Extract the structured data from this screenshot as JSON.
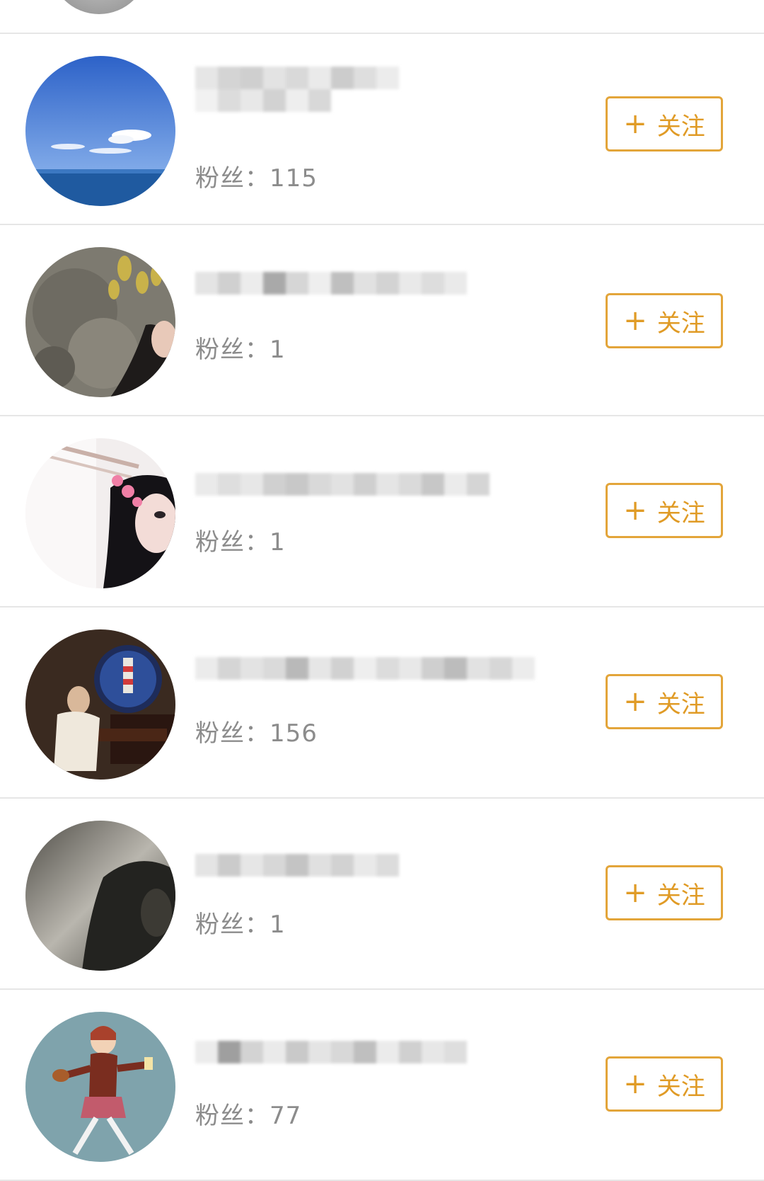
{
  "colors": {
    "accent": "#e09b26",
    "divider": "#e6e6e6",
    "muted_text": "#8c8c8c"
  },
  "follow_label": "关注",
  "plus_symbol": "+",
  "users": [
    {
      "fans_label": "粉丝：",
      "fans_count": "115",
      "avatar": "ocean-sky"
    },
    {
      "fans_label": "粉丝：",
      "fans_count": "1",
      "avatar": "rock-girl"
    },
    {
      "fans_label": "粉丝：",
      "fans_count": "1",
      "avatar": "girl-portrait"
    },
    {
      "fans_label": "粉丝：",
      "fans_count": "156",
      "avatar": "pianist-lighthouse"
    },
    {
      "fans_label": "粉丝：",
      "fans_count": "1",
      "avatar": "hooded-figure"
    },
    {
      "fans_label": "粉丝：",
      "fans_count": "77",
      "avatar": "cartoon-man"
    }
  ]
}
